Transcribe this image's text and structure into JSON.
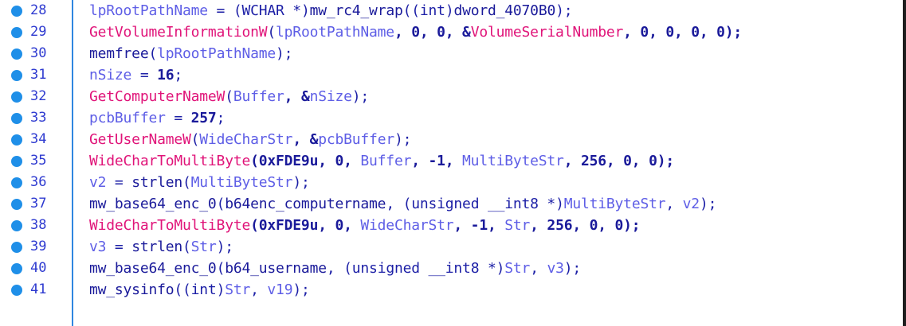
{
  "lines": [
    {
      "number": "28",
      "tokens": [
        {
          "t": "lpRootPathName",
          "c": "tok-var"
        },
        {
          "t": " = (",
          "c": "tok-punct"
        },
        {
          "t": "WCHAR",
          "c": "tok-kw"
        },
        {
          "t": " *)",
          "c": "tok-punct"
        },
        {
          "t": "mw_rc4_wrap",
          "c": "tok-func"
        },
        {
          "t": "((",
          "c": "tok-punct"
        },
        {
          "t": "int",
          "c": "tok-kw"
        },
        {
          "t": ")",
          "c": "tok-punct"
        },
        {
          "t": "dword_4070B0",
          "c": "tok-func"
        },
        {
          "t": ");",
          "c": "tok-punct"
        }
      ]
    },
    {
      "number": "29",
      "tokens": [
        {
          "t": "GetVolumeInformationW",
          "c": "tok-api"
        },
        {
          "t": "(",
          "c": "tok-punct"
        },
        {
          "t": "lpRootPathName",
          "c": "tok-var"
        },
        {
          "t": ", 0, 0, &",
          "c": "tok-num"
        },
        {
          "t": "VolumeSerialNumber",
          "c": "tok-api"
        },
        {
          "t": ", 0, 0, 0, 0);",
          "c": "tok-num"
        }
      ]
    },
    {
      "number": "30",
      "tokens": [
        {
          "t": "memfree",
          "c": "tok-func"
        },
        {
          "t": "(",
          "c": "tok-punct"
        },
        {
          "t": "lpRootPathName",
          "c": "tok-var"
        },
        {
          "t": ");",
          "c": "tok-punct"
        }
      ]
    },
    {
      "number": "31",
      "tokens": [
        {
          "t": "nSize",
          "c": "tok-var"
        },
        {
          "t": " = ",
          "c": "tok-punct"
        },
        {
          "t": "16",
          "c": "tok-num"
        },
        {
          "t": ";",
          "c": "tok-punct"
        }
      ]
    },
    {
      "number": "32",
      "tokens": [
        {
          "t": "GetComputerNameW",
          "c": "tok-api"
        },
        {
          "t": "(",
          "c": "tok-punct"
        },
        {
          "t": "Buffer",
          "c": "tok-var"
        },
        {
          "t": ", &",
          "c": "tok-num"
        },
        {
          "t": "nSize",
          "c": "tok-var"
        },
        {
          "t": ");",
          "c": "tok-punct"
        }
      ]
    },
    {
      "number": "33",
      "tokens": [
        {
          "t": "pcbBuffer",
          "c": "tok-var"
        },
        {
          "t": " = ",
          "c": "tok-punct"
        },
        {
          "t": "257",
          "c": "tok-num"
        },
        {
          "t": ";",
          "c": "tok-punct"
        }
      ]
    },
    {
      "number": "34",
      "tokens": [
        {
          "t": "GetUserNameW",
          "c": "tok-api"
        },
        {
          "t": "(",
          "c": "tok-punct"
        },
        {
          "t": "WideCharStr",
          "c": "tok-var"
        },
        {
          "t": ", &",
          "c": "tok-num"
        },
        {
          "t": "pcbBuffer",
          "c": "tok-var"
        },
        {
          "t": ");",
          "c": "tok-punct"
        }
      ]
    },
    {
      "number": "35",
      "tokens": [
        {
          "t": "WideCharToMultiByte",
          "c": "tok-api"
        },
        {
          "t": "(0xFDE9u, 0, ",
          "c": "tok-num"
        },
        {
          "t": "Buffer",
          "c": "tok-var"
        },
        {
          "t": ", -1, ",
          "c": "tok-num"
        },
        {
          "t": "MultiByteStr",
          "c": "tok-var"
        },
        {
          "t": ", 256, 0, 0);",
          "c": "tok-num"
        }
      ]
    },
    {
      "number": "36",
      "tokens": [
        {
          "t": "v2",
          "c": "tok-var"
        },
        {
          "t": " = ",
          "c": "tok-punct"
        },
        {
          "t": "strlen",
          "c": "tok-func"
        },
        {
          "t": "(",
          "c": "tok-punct"
        },
        {
          "t": "MultiByteStr",
          "c": "tok-var"
        },
        {
          "t": ");",
          "c": "tok-punct"
        }
      ]
    },
    {
      "number": "37",
      "tokens": [
        {
          "t": "mw_base64_enc_0",
          "c": "tok-func"
        },
        {
          "t": "(",
          "c": "tok-punct"
        },
        {
          "t": "b64enc_computername",
          "c": "tok-func"
        },
        {
          "t": ", (",
          "c": "tok-punct"
        },
        {
          "t": "unsigned __int8",
          "c": "tok-kw"
        },
        {
          "t": " *)",
          "c": "tok-punct"
        },
        {
          "t": "MultiByteStr",
          "c": "tok-var"
        },
        {
          "t": ", ",
          "c": "tok-punct"
        },
        {
          "t": "v2",
          "c": "tok-var"
        },
        {
          "t": ");",
          "c": "tok-punct"
        }
      ]
    },
    {
      "number": "38",
      "tokens": [
        {
          "t": "WideCharToMultiByte",
          "c": "tok-api"
        },
        {
          "t": "(0xFDE9u, 0, ",
          "c": "tok-num"
        },
        {
          "t": "WideCharStr",
          "c": "tok-var"
        },
        {
          "t": ", -1, ",
          "c": "tok-num"
        },
        {
          "t": "Str",
          "c": "tok-var"
        },
        {
          "t": ", 256, 0, 0);",
          "c": "tok-num"
        }
      ]
    },
    {
      "number": "39",
      "tokens": [
        {
          "t": "v3",
          "c": "tok-var"
        },
        {
          "t": " = ",
          "c": "tok-punct"
        },
        {
          "t": "strlen",
          "c": "tok-func"
        },
        {
          "t": "(",
          "c": "tok-punct"
        },
        {
          "t": "Str",
          "c": "tok-var"
        },
        {
          "t": ");",
          "c": "tok-punct"
        }
      ]
    },
    {
      "number": "40",
      "tokens": [
        {
          "t": "mw_base64_enc_0",
          "c": "tok-func"
        },
        {
          "t": "(",
          "c": "tok-punct"
        },
        {
          "t": "b64_username",
          "c": "tok-func"
        },
        {
          "t": ", (",
          "c": "tok-punct"
        },
        {
          "t": "unsigned __int8",
          "c": "tok-kw"
        },
        {
          "t": " *)",
          "c": "tok-punct"
        },
        {
          "t": "Str",
          "c": "tok-var"
        },
        {
          "t": ", ",
          "c": "tok-punct"
        },
        {
          "t": "v3",
          "c": "tok-var"
        },
        {
          "t": ");",
          "c": "tok-punct"
        }
      ]
    },
    {
      "number": "41",
      "tokens": [
        {
          "t": "mw_sysinfo",
          "c": "tok-func"
        },
        {
          "t": "((",
          "c": "tok-punct"
        },
        {
          "t": "int",
          "c": "tok-kw"
        },
        {
          "t": ")",
          "c": "tok-punct"
        },
        {
          "t": "Str",
          "c": "tok-var"
        },
        {
          "t": ", ",
          "c": "tok-punct"
        },
        {
          "t": "v19",
          "c": "tok-var"
        },
        {
          "t": ");",
          "c": "tok-punct"
        }
      ]
    }
  ],
  "colors": {
    "line_number": "#2e3ad0",
    "breakpoint_dot": "#1f8fe8",
    "gutter_separator": "#2f86e0",
    "api_call": "#e01479",
    "variable": "#5e5ee6",
    "function": "#1a1a9a",
    "frame_border": "#1f1f1f"
  }
}
